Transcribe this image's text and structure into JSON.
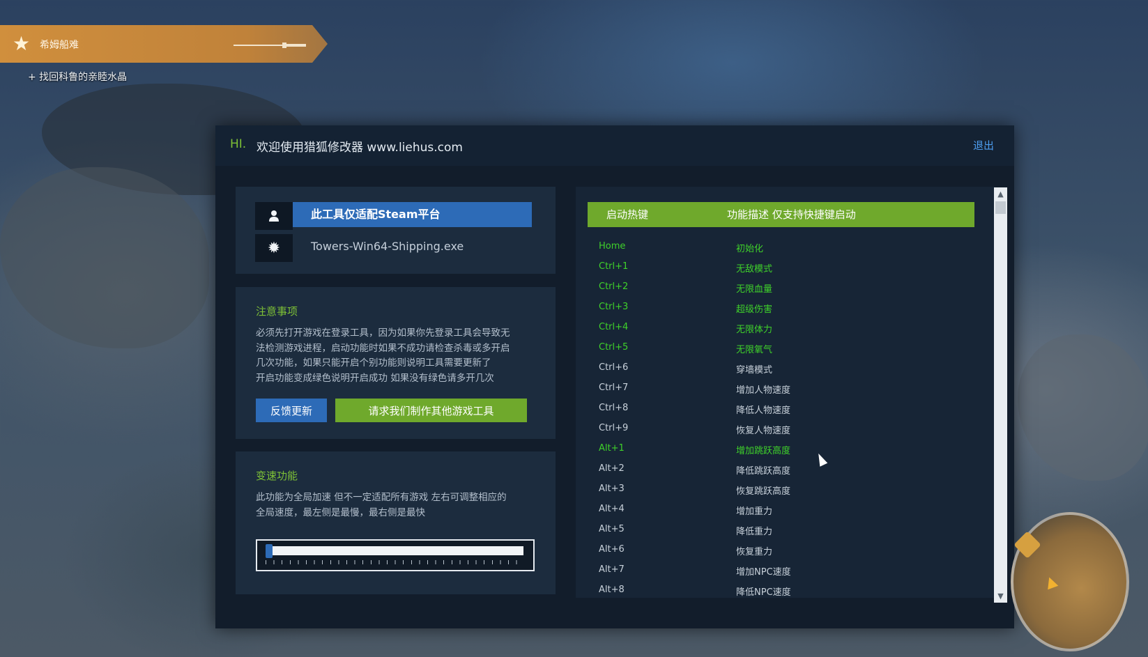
{
  "quest": {
    "title": "希姆船难",
    "subtitle": "+ 找回科鲁的亲睦水晶"
  },
  "trainer": {
    "hi": "HI.",
    "welcome": "欢迎使用猎狐修改器 www.liehus.com",
    "exit": "退出",
    "platform_note": "此工具仅适配Steam平台",
    "process_name": "Towers-Win64-Shipping.exe",
    "notice": {
      "title": "注意事项",
      "lines": [
        "必须先打开游戏在登录工具，因为如果你先登录工具会导致无",
        "法检测游戏进程，启动功能时如果不成功请检查杀毒或多开启",
        "几次功能，如果只能开启个别功能则说明工具需要更新了",
        "开启功能变成绿色说明开启成功 如果没有绿色请多开几次"
      ],
      "feedback_button": "反馈更新",
      "request_button": "请求我们制作其他游戏工具"
    },
    "speed": {
      "title": "变速功能",
      "lines": [
        "此功能为全局加速 但不一定适配所有游戏 左右可调整相应的",
        "全局速度，最左侧是最慢，最右侧是最快"
      ],
      "level": 0.0
    },
    "hotkeys": {
      "header_key": "启动热键",
      "header_desc": "功能描述 仅支持快捷键启动",
      "rows": [
        {
          "key": "Home",
          "desc": "初始化",
          "active": true
        },
        {
          "key": "Ctrl+1",
          "desc": "无敌模式",
          "active": true
        },
        {
          "key": "Ctrl+2",
          "desc": "无限血量",
          "active": true
        },
        {
          "key": "Ctrl+3",
          "desc": "超级伤害",
          "active": true
        },
        {
          "key": "Ctrl+4",
          "desc": "无限体力",
          "active": true
        },
        {
          "key": "Ctrl+5",
          "desc": "无限氧气",
          "active": true
        },
        {
          "key": "Ctrl+6",
          "desc": "穿墙模式",
          "active": false
        },
        {
          "key": "Ctrl+7",
          "desc": "增加人物速度",
          "active": false
        },
        {
          "key": "Ctrl+8",
          "desc": "降低人物速度",
          "active": false
        },
        {
          "key": "Ctrl+9",
          "desc": "恢复人物速度",
          "active": false
        },
        {
          "key": "Alt+1",
          "desc": "增加跳跃高度",
          "active": true
        },
        {
          "key": "Alt+2",
          "desc": "降低跳跃高度",
          "active": false
        },
        {
          "key": "Alt+3",
          "desc": "恢复跳跃高度",
          "active": false
        },
        {
          "key": "Alt+4",
          "desc": "增加重力",
          "active": false
        },
        {
          "key": "Alt+5",
          "desc": "降低重力",
          "active": false
        },
        {
          "key": "Alt+6",
          "desc": "恢复重力",
          "active": false
        },
        {
          "key": "Alt+7",
          "desc": "增加NPC速度",
          "active": false
        },
        {
          "key": "Alt+8",
          "desc": "降低NPC速度",
          "active": false
        }
      ]
    }
  },
  "colors": {
    "accent_green": "#6fa92c",
    "active_text": "#3fd12a",
    "accent_blue": "#2d6bb7",
    "quest_banner": "#c0823a"
  },
  "icons": {
    "quest": "star-icon",
    "user": "user-icon",
    "process": "gear-icon"
  }
}
